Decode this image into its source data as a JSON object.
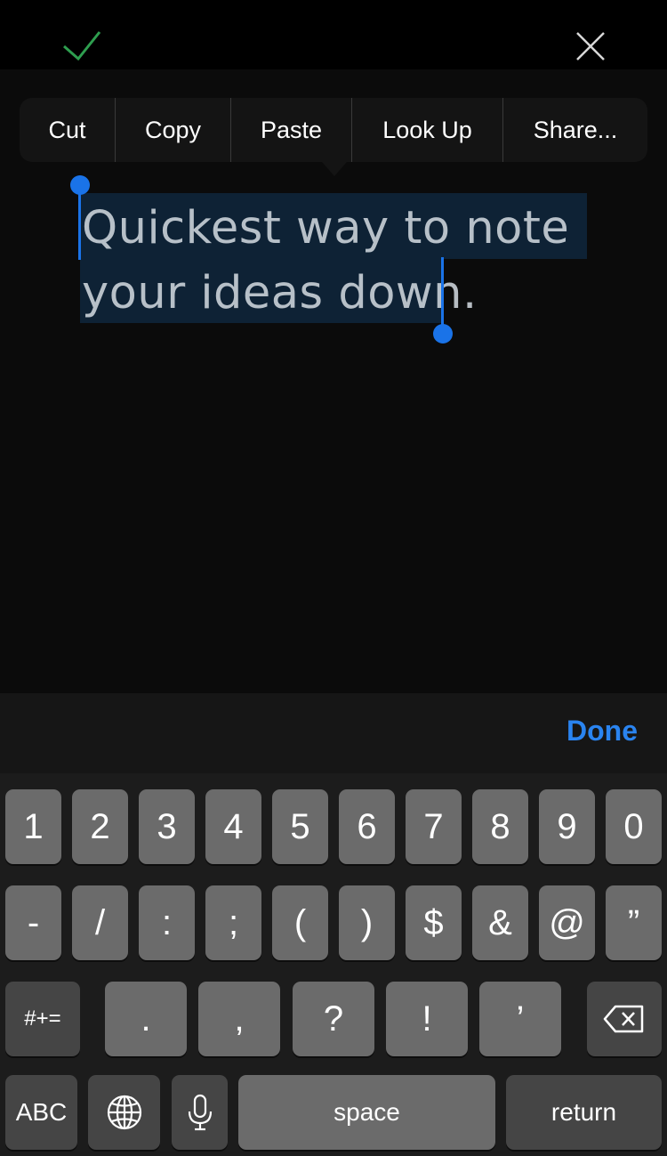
{
  "topbar": {
    "confirm_icon": "checkmark-icon",
    "close_icon": "close-icon"
  },
  "context_menu": {
    "items": [
      "Cut",
      "Copy",
      "Paste",
      "Look Up",
      "Share..."
    ]
  },
  "note": {
    "line1": "Quickest way to note",
    "line2": "your ideas down."
  },
  "accessory": {
    "done_label": "Done"
  },
  "keyboard": {
    "row1": [
      "1",
      "2",
      "3",
      "4",
      "5",
      "6",
      "7",
      "8",
      "9",
      "0"
    ],
    "row2": [
      "-",
      "/",
      ":",
      ";",
      "(",
      ")",
      "$",
      "&",
      "@",
      "”"
    ],
    "row3": {
      "toggle": "#+=",
      "keys": [
        ".",
        ",",
        "?",
        "!",
        "’"
      ]
    },
    "row4": {
      "abc": "ABC",
      "space": "space",
      "return": "return"
    }
  },
  "colors": {
    "accent": "#1a73e8",
    "done": "#2a84f0",
    "check": "#2e9e4f"
  }
}
